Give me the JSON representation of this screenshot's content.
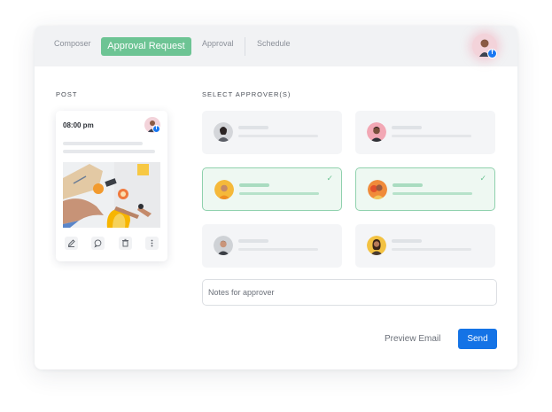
{
  "tabs": [
    {
      "label": "Composer",
      "active": false
    },
    {
      "label": "Approval Request",
      "active": true
    },
    {
      "label": "Approval",
      "active": false
    },
    {
      "label": "Schedule",
      "active": false
    }
  ],
  "post": {
    "section_label": "POST",
    "time": "08:00 pm",
    "actions": [
      "edit-icon",
      "comment-icon",
      "trash-icon",
      "more-icon"
    ]
  },
  "approvers": {
    "section_label": "SELECT APPROVER(S)",
    "items": [
      {
        "selected": false
      },
      {
        "selected": false
      },
      {
        "selected": true
      },
      {
        "selected": true
      },
      {
        "selected": false
      },
      {
        "selected": false
      }
    ]
  },
  "notes": {
    "placeholder": "Notes for approver"
  },
  "footer": {
    "preview_label": "Preview Email",
    "send_label": "Send"
  },
  "colors": {
    "accent_green": "#6dc494",
    "primary_blue": "#1473e6",
    "facebook_blue": "#1877f2"
  }
}
